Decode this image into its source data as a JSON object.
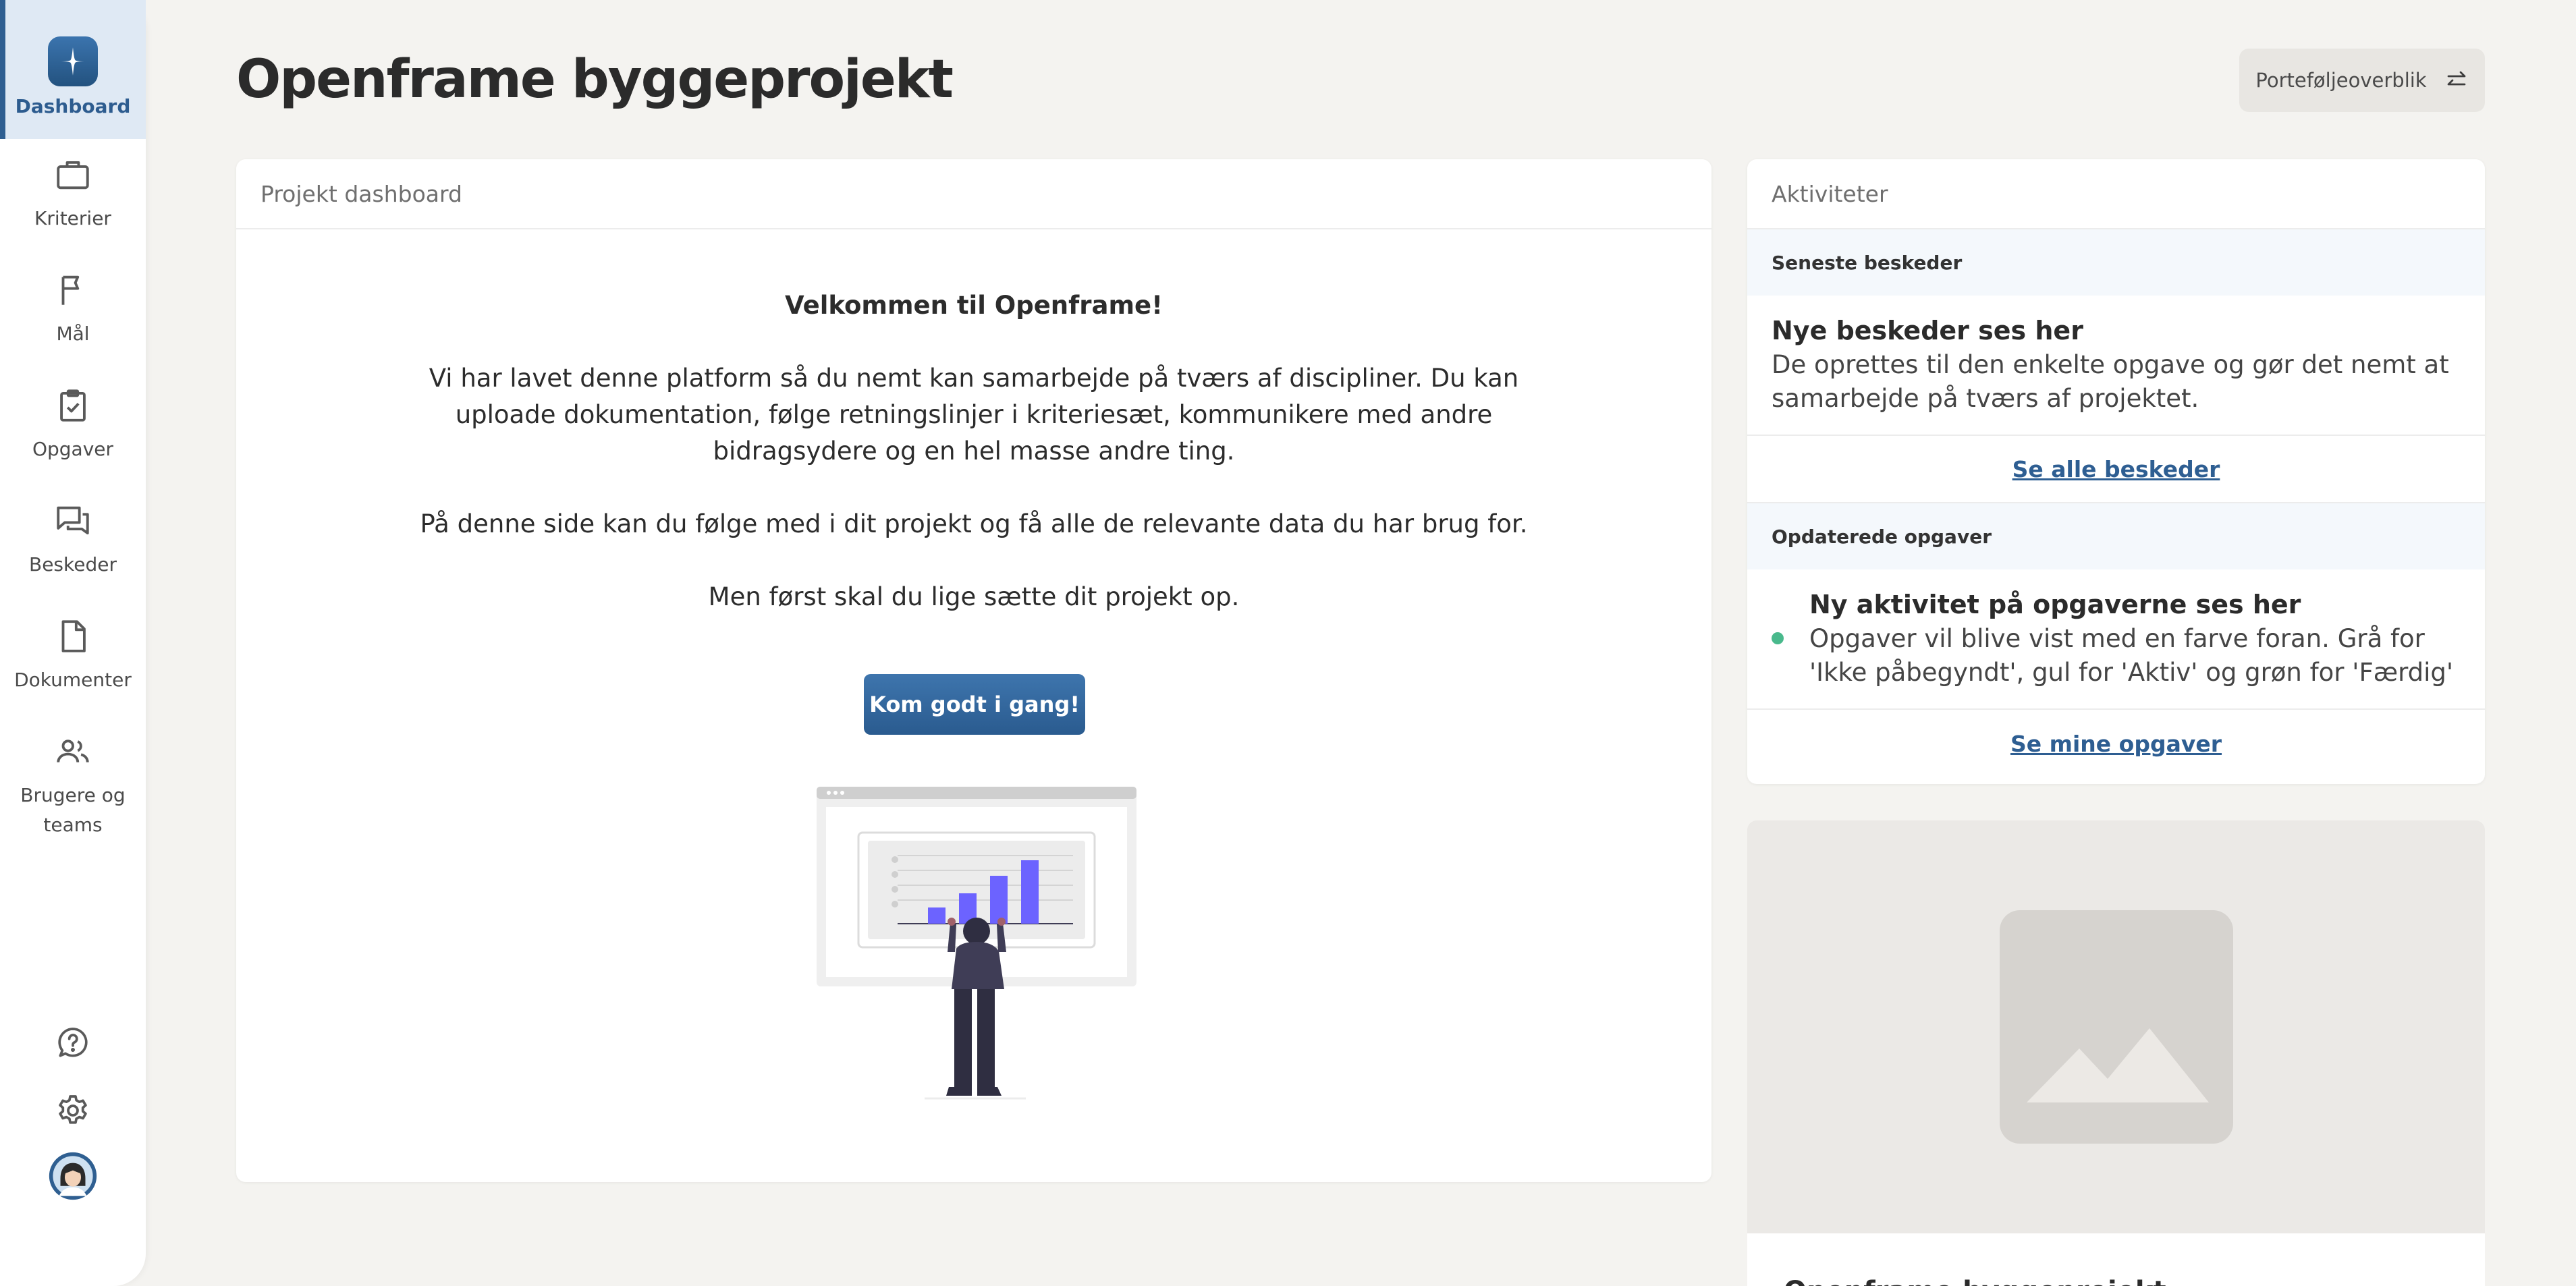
{
  "sidebar": {
    "items": [
      {
        "label": "Dashboard"
      },
      {
        "label": "Kriterier"
      },
      {
        "label": "Mål"
      },
      {
        "label": "Opgaver"
      },
      {
        "label": "Beskeder"
      },
      {
        "label": "Dokumenter"
      },
      {
        "label": "Brugere og teams"
      }
    ]
  },
  "header": {
    "title": "Openframe byggeprojekt",
    "portfolio_button": "Porteføljeoverblik"
  },
  "dashboard": {
    "header": "Projekt dashboard",
    "welcome_title": "Velkommen til Openframe!",
    "paragraph1": "Vi har lavet denne platform så du nemt kan samarbejde på tværs af discipliner. Du kan uploade dokumentation, følge retningslinjer i kriteriesæt, kommunikere med andre bidragsydere og en hel masse andre ting.",
    "paragraph2": "På denne side kan du følge med i dit projekt og få alle de relevante data du har brug for.",
    "paragraph3": "Men først skal du lige sætte dit projekt op.",
    "start_button": "Kom godt i gang!"
  },
  "activities": {
    "header": "Aktiviteter",
    "messages_section": "Seneste beskeder",
    "messages_title": "Nye beskeder ses her",
    "messages_text": "De oprettes til den enkelte opgave og gør det nemt at samarbejde på tværs af projektet.",
    "messages_link": "Se alle beskeder",
    "tasks_section": "Opdaterede opgaver",
    "tasks_title": "Ny aktivitet på opgaverne ses her",
    "tasks_text": "Opgaver vil blive vist med en farve foran. Grå for 'Ikke påbegyndt', gul for 'Aktiv' og grøn for 'Færdig'",
    "tasks_link": "Se mine opgaver"
  },
  "project_card": {
    "title": "Openframe byggeprojekt"
  },
  "colors": {
    "accent": "#2f5f91",
    "status_green": "#49b98c",
    "background": "#f4f3f0"
  }
}
